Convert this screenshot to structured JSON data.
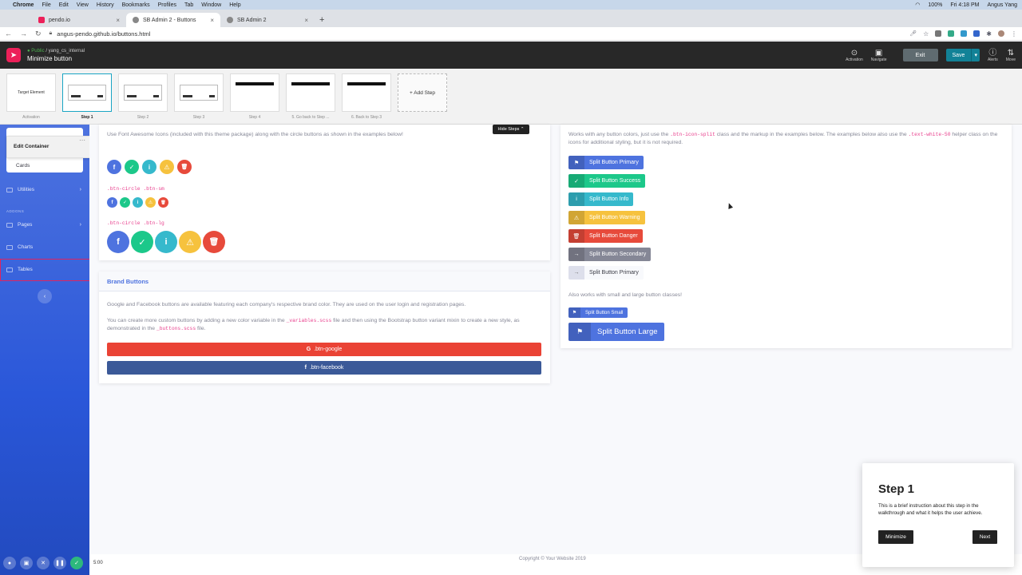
{
  "menubar": {
    "items": [
      "Chrome",
      "File",
      "Edit",
      "View",
      "History",
      "Bookmarks",
      "Profiles",
      "Tab",
      "Window",
      "Help"
    ],
    "battery": "100%",
    "clock": "Fri 4:18 PM",
    "user": "Angus Yang"
  },
  "tabs": [
    {
      "title": "pendo.io",
      "color": "#ec2059"
    },
    {
      "title": "SB Admin 2 - Buttons",
      "color": "#4e73df"
    },
    {
      "title": "SB Admin 2",
      "color": "#4e73df"
    }
  ],
  "address": {
    "url": "angus-pendo.github.io/buttons.html"
  },
  "pendo": {
    "visibility": "Public",
    "app": "yang_cs_internal",
    "guide_title": "Minimize button",
    "tools": {
      "activation": "Activation",
      "navigate": "Navigate",
      "alerts": "Alerts",
      "move": "Move"
    },
    "exit": "Exit",
    "save": "Save"
  },
  "steps": [
    {
      "label": "Activation",
      "thumb": "Target Element"
    },
    {
      "label": "Step 1"
    },
    {
      "label": "Step 2"
    },
    {
      "label": "Step 3"
    },
    {
      "label": "Step 4"
    },
    {
      "label": "5. Go back to Step ..."
    },
    {
      "label": "6. Back to Step 3"
    }
  ],
  "add_step": "+ Add Step",
  "hide_steps": "Hide Steps",
  "sidebar": {
    "edit_container": "Edit Container",
    "cards": "Cards",
    "utilities": "Utilities",
    "heading_addons": "ADDONS",
    "pages": "Pages",
    "charts": "Charts",
    "tables": "Tables"
  },
  "circle_card": {
    "intro": "Use Font Awesome Icons (included with this theme package) along with the circle buttons as shown in the examples below!",
    "sm_label": ".btn-circle .btn-sm",
    "lg_label": ".btn-circle .btn-lg",
    "colors": [
      "#4e73df",
      "#1cc88a",
      "#36b9cc",
      "#f6c23e",
      "#e74a3b"
    ],
    "icons": [
      "f",
      "✓",
      "i",
      "⚠",
      "🗑"
    ]
  },
  "brand_card": {
    "title": "Brand Buttons",
    "p1": "Google and Facebook buttons are available featuring each company's respective brand color. They are used on the user login and registration pages.",
    "p2_a": "You can create more custom buttons by adding a new color variable in the",
    "p2_code1": "_variables.scss",
    "p2_b": "file and then using the Bootstrap button variant mixin to create a new style, as demonstrated in the",
    "p2_code2": "_buttons.scss",
    "p2_c": "file.",
    "google": ".btn-google",
    "facebook": ".btn-facebook"
  },
  "split_card": {
    "intro_a": "Works with any button colors, just use the",
    "intro_code1": ".btn-icon-split",
    "intro_b": "class and the markup in the examples below. The examples below also use the",
    "intro_code2": ".text-white-50",
    "intro_c": "helper class on the icons for additional styling, but it is not required.",
    "buttons": [
      {
        "label": "Split Button Primary",
        "color": "#4e73df",
        "icon": "⚑"
      },
      {
        "label": "Split Button Success",
        "color": "#1cc88a",
        "icon": "✓"
      },
      {
        "label": "Split Button Info",
        "color": "#36b9cc",
        "icon": "i"
      },
      {
        "label": "Split Button Warning",
        "color": "#f6c23e",
        "icon": "⚠"
      },
      {
        "label": "Split Button Danger",
        "color": "#e74a3b",
        "icon": "🗑"
      },
      {
        "label": "Split Button Secondary",
        "color": "#858796",
        "icon": "→"
      },
      {
        "label": "Split Button Primary",
        "color": "#f8f9fc",
        "icon": "→"
      }
    ],
    "also": "Also works with small and large button classes!",
    "small": "Split Button Small",
    "large": "Split Button Large"
  },
  "footer": "Copyright © Your Website 2019",
  "guide": {
    "title": "Step 1",
    "body": "This is a brief instruction about this step in the walkthrough and what it helps the user achieve.",
    "minimize": "Minimize",
    "next": "Next"
  },
  "recorder": {
    "time": "5:00"
  }
}
